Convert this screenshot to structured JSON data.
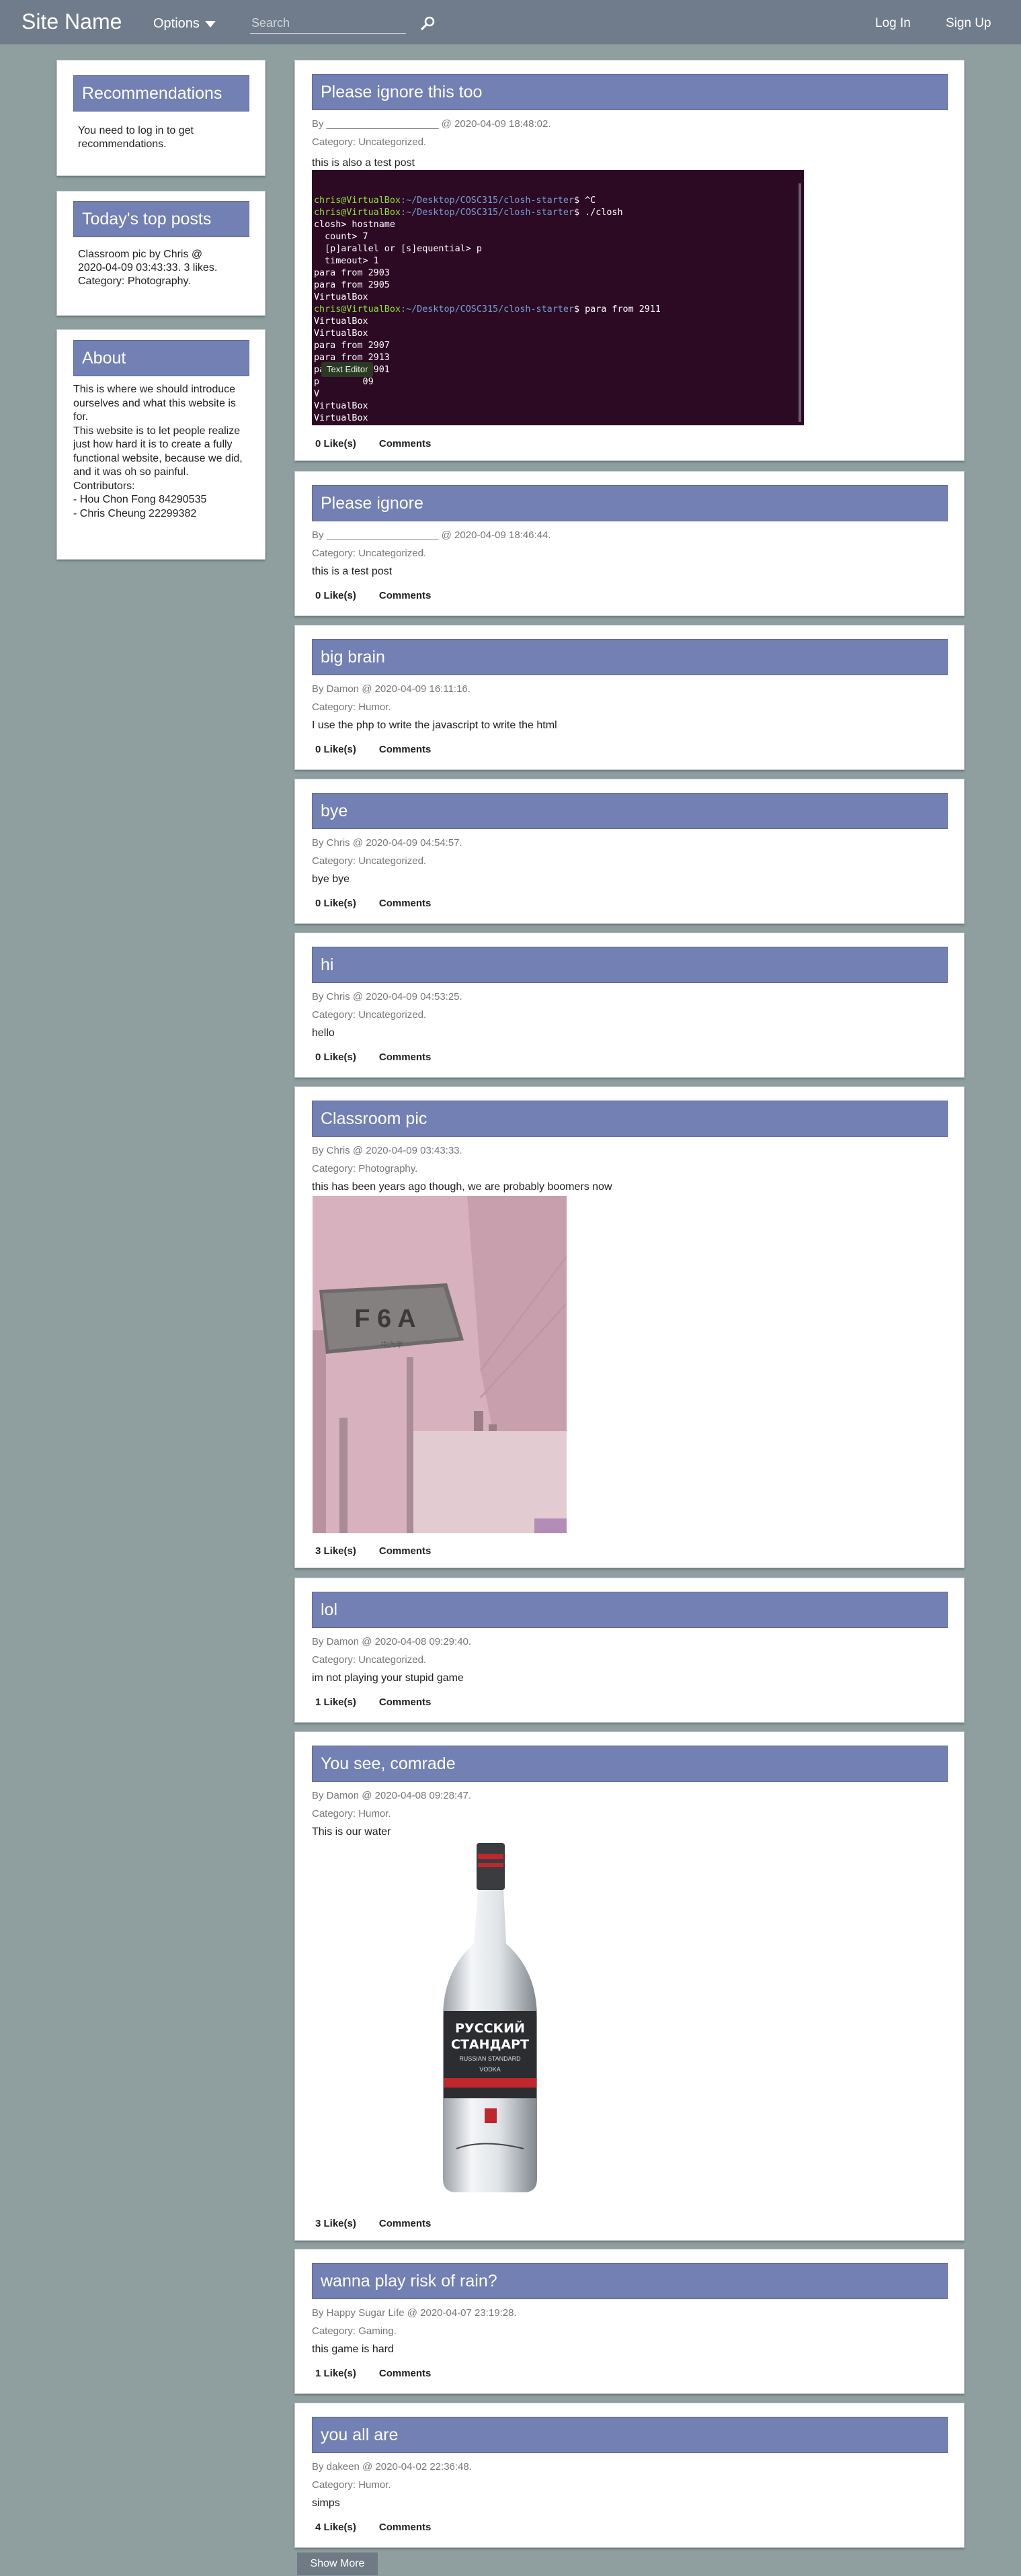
{
  "nav": {
    "site_name": "Site Name",
    "options_label": "Options",
    "search_placeholder": "Search",
    "login": "Log In",
    "signup": "Sign Up"
  },
  "sidebar": {
    "recommendations": {
      "title": "Recommendations",
      "text": [
        "You need to log in to get",
        "recommendations."
      ]
    },
    "top_posts": {
      "title": "Today's top posts",
      "text": [
        "Classroom pic by Chris @",
        "2020-04-09 03:43:33. 3 likes.",
        "Category: Photography."
      ]
    },
    "about": {
      "title": "About",
      "text": [
        "This is where we should introduce",
        "ourselves and what this website is",
        "for.",
        "This website is to let people realize",
        "just how hard it is to create a fully",
        "functional website, because we did,",
        "and it was oh so painful.",
        "Contributors:",
        "- Hou Chon Fong 84290535",
        "- Chris Cheung 22299382"
      ]
    }
  },
  "terminal": {
    "lines": [
      {
        "user": "chris@VirtualBox",
        "path": ":~/Desktop/COSC315/closh-starter",
        "cmd": "$ ^C"
      },
      {
        "user": "chris@VirtualBox",
        "path": ":~/Desktop/COSC315/closh-starter",
        "cmd": "$ ./closh"
      },
      {
        "text": "closh> hostname"
      },
      {
        "text": "  count> 7"
      },
      {
        "text": "  [p]arallel or [s]equential> p"
      },
      {
        "text": "  timeout> 1"
      },
      {
        "text": "para from 2903"
      },
      {
        "text": "para from 2905"
      },
      {
        "text": "VirtualBox"
      },
      {
        "user": "chris@VirtualBox",
        "path": ":~/Desktop/COSC315/closh-starter",
        "cmd": "$ para from 2911"
      },
      {
        "text": "VirtualBox"
      },
      {
        "text": "VirtualBox"
      },
      {
        "text": "para from 2907"
      },
      {
        "text": "para from 2913"
      },
      {
        "text": "para from 2901"
      },
      {
        "text": "p        09"
      },
      {
        "text": "V"
      },
      {
        "text": "VirtualBox"
      },
      {
        "text": "VirtualBox"
      },
      {
        "text": "VirtualBox"
      }
    ],
    "tooltip": "Text Editor"
  },
  "posts": [
    {
      "title": "Please ignore this too",
      "meta": "By ____________________ @ 2020-04-09 18:48:02.",
      "category": "Category: Uncategorized.",
      "body": "this is also a test post",
      "likes": "0 Like(s)",
      "comments": "Comments"
    },
    {
      "title": "Please ignore",
      "meta": "By ____________________ @ 2020-04-09 18:46:44.",
      "category": "Category: Uncategorized.",
      "body": "this is a test post",
      "likes": "0 Like(s)",
      "comments": "Comments"
    },
    {
      "title": "big brain",
      "meta": "By Damon @ 2020-04-09 16:11:16.",
      "category": "Category: Humor.",
      "body": "I use the php to write the javascript to write the html",
      "likes": "0 Like(s)",
      "comments": "Comments"
    },
    {
      "title": "bye",
      "meta": "By Chris @ 2020-04-09 04:54:57.",
      "category": "Category: Uncategorized.",
      "body": "bye bye",
      "likes": "0 Like(s)",
      "comments": "Comments"
    },
    {
      "title": "hi",
      "meta": "By Chris @ 2020-04-09 04:53:25.",
      "category": "Category: Uncategorized.",
      "body": "hello",
      "likes": "0 Like(s)",
      "comments": "Comments"
    },
    {
      "title": "Classroom pic",
      "meta": "By Chris @ 2020-04-09 03:43:33.",
      "category": "Category: Photography.",
      "body": "this has been years ago though, we are probably boomers now",
      "likes": "3 Like(s)",
      "comments": "Comments",
      "sign_text": "F 6 A",
      "sign_sub": "中六甲"
    },
    {
      "title": "lol",
      "meta": "By Damon @ 2020-04-08 09:29:40.",
      "category": "Category: Uncategorized.",
      "body": "im not playing your stupid game",
      "likes": "1 Like(s)",
      "comments": "Comments"
    },
    {
      "title": "You see, comrade",
      "meta": "By Damon @ 2020-04-08 09:28:47.",
      "category": "Category: Humor.",
      "body": "This is our water",
      "likes": "3 Like(s)",
      "comments": "Comments",
      "label_lines": [
        "РУССКИЙ",
        "СТАНДАРТ"
      ],
      "label_small": "RUSSIAN STANDARD",
      "label_vodka": "VODKA"
    },
    {
      "title": "wanna play risk of rain?",
      "meta": "By Happy Sugar Life @ 2020-04-07 23:19:28.",
      "category": "Category: Gaming.",
      "body": "this game is hard",
      "likes": "1 Like(s)",
      "comments": "Comments"
    },
    {
      "title": "you all are",
      "meta": "By dakeen @ 2020-04-02 22:36:48.",
      "category": "Category: Humor.",
      "body": "simps",
      "likes": "4 Like(s)",
      "comments": "Comments"
    }
  ],
  "show_more": "Show More"
}
